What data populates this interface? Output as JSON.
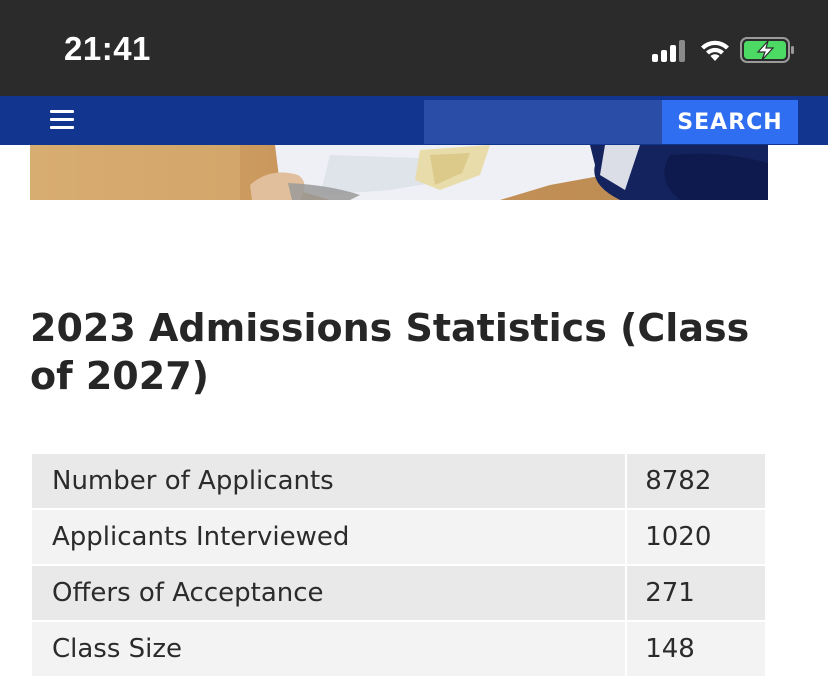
{
  "status_bar": {
    "time": "21:41",
    "icons": [
      "cellular-signal-icon",
      "wifi-icon",
      "battery-charging-icon"
    ]
  },
  "nav": {
    "menu_icon": "hamburger-menu-icon",
    "search_placeholder": "",
    "search_label": "SEARCH"
  },
  "colors": {
    "status_bar_bg": "#2b2b2b",
    "nav_bg": "#12358f",
    "search_input_bg": "#2a4ea8",
    "search_button_bg": "#2f6ef0",
    "battery_green": "#4cd964",
    "table_row_bg": "#e9e9e9",
    "title_text": "#262626"
  },
  "page": {
    "title": "2023 Admissions Statistics (Class of 2027)"
  },
  "stats": {
    "rows": [
      {
        "label": "Number of Applicants",
        "value": "8782"
      },
      {
        "label": "Applicants Interviewed",
        "value": "1020"
      },
      {
        "label": "Offers of Acceptance",
        "value": "271"
      },
      {
        "label": "Class Size",
        "value": "148"
      }
    ]
  }
}
